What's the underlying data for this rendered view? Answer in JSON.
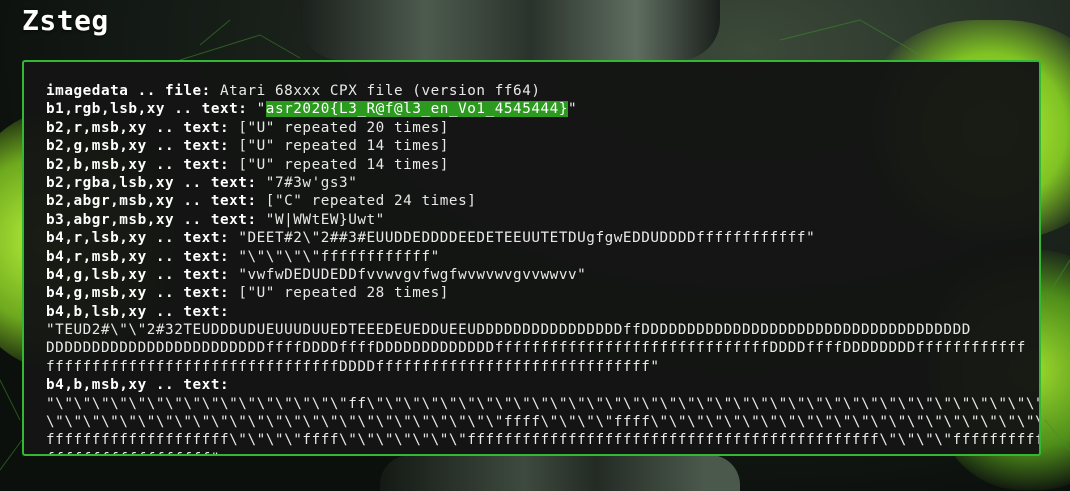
{
  "page": {
    "title": "Zsteg"
  },
  "colors": {
    "accent": "#33b833",
    "highlight": "#2b9a1e",
    "terminal_bg": "#141514",
    "text": "#e8e8e8"
  },
  "output": {
    "lines": [
      {
        "label": "imagedata .. file:",
        "value": " Atari 68xxx CPX file (version ff64)"
      },
      {
        "label": "b1,rgb,lsb,xy .. text:",
        "value": " \"",
        "highlight": "asr2020{L3_R@f@l3_en_Vo1_4545444}",
        "value_after": "\""
      },
      {
        "label": "b2,r,msb,xy .. text:",
        "value": " [\"U\" repeated 20 times]"
      },
      {
        "label": "b2,g,msb,xy .. text:",
        "value": " [\"U\" repeated 14 times]"
      },
      {
        "label": "b2,b,msb,xy .. text:",
        "value": " [\"U\" repeated 14 times]"
      },
      {
        "label": "b2,rgba,lsb,xy .. text:",
        "value": " \"7#3w'gs3\""
      },
      {
        "label": "b2,abgr,msb,xy .. text:",
        "value": " [\"C\" repeated 24 times]"
      },
      {
        "label": "b3,abgr,msb,xy .. text:",
        "value": " \"W|WWtEW}Uwt\""
      },
      {
        "label": "b4,r,lsb,xy .. text:",
        "value": " \"DEET#2\\\"2##3#EUUDDEDDDDEEDETEEUUTETDUgfgwEDDUDDDDffffffffffff\""
      },
      {
        "label": "b4,r,msb,xy .. text:",
        "value": " \"\\\"\\\"\\\"\\\"ffffffffffff\""
      },
      {
        "label": "b4,g,lsb,xy .. text:",
        "value": " \"vwfwDEDUDEDDfvvwvgvfwgfwvwvwvgvvwwvv\""
      },
      {
        "label": "b4,g,msb,xy .. text:",
        "value": " [\"U\" repeated 28 times]"
      },
      {
        "label": "b4,b,lsb,xy .. text:",
        "value": ""
      },
      {
        "label": "",
        "value": "\"TEUD2#\\\"\\\"2#32TEUDDDUDUEUUUDUUEDTEEEDEUEDDUEEUDDDDDDDDDDDDDDDDffDDDDDDDDDDDDDDDDDDDDDDDDDDDDDDDDDDDD"
      },
      {
        "label": "",
        "value": "DDDDDDDDDDDDDDDDDDDDDDDDffffDDDDffffDDDDDDDDDDDDDffffffffffffffffffffffffffffffDDDDffffDDDDDDDDffffffffffff"
      },
      {
        "label": "",
        "value": "ffffffffffffffffffffffffffffffffDDDDffffffffffffffffffffffffffffff\""
      },
      {
        "label": "b4,b,msb,xy .. text:",
        "value": ""
      },
      {
        "label": "",
        "value": "\"\\\"\\\"\\\"\\\"\\\"\\\"\\\"\\\"\\\"\\\"\\\"\\\"\\\"\\\"\\\"\\\"ff\\\"\\\"\\\"\\\"\\\"\\\"\\\"\\\"\\\"\\\"\\\"\\\"\\\"\\\"\\\"\\\"\\\"\\\"\\\"\\\"\\\"\\\"\\\"\\\"\\\"\\\"\\\"\\\"\\\"\\\"\\\"\\\"\\\"\\\"\\\"\\\"\\\"\\\"\\\"\\\"\\\"\\\"\\\"\\\""
      },
      {
        "label": "",
        "value": "\\\"\\\"\\\"\\\"\\\"\\\"\\\"\\\"\\\"\\\"\\\"\\\"\\\"\\\"\\\"\\\"\\\"\\\"\\\"\\\"\\\"\\\"\\\"\\\"\\\"ffff\\\"\\\"\\\"\\\"ffff\\\"\\\"\\\"\\\"\\\"\\\"\\\"\\\"\\\"\\\"\\\"\\\"\\\"\\\"\\\"\\\"\\\"\\\"\\\"\\\"\\\"\\\"ffffffffffff"
      },
      {
        "label": "",
        "value": "ffffffffffffffffffff\\\"\\\"\\\"\\\"ffff\\\"\\\"\\\"\\\"\\\"\\\"\\\"fffffffffffffffffffffffffffffffffffffffffffff\\\"\\\"\\\"\\\"ffffffffffff"
      },
      {
        "label": "",
        "value": "ffffffffffffffffff\""
      }
    ]
  }
}
